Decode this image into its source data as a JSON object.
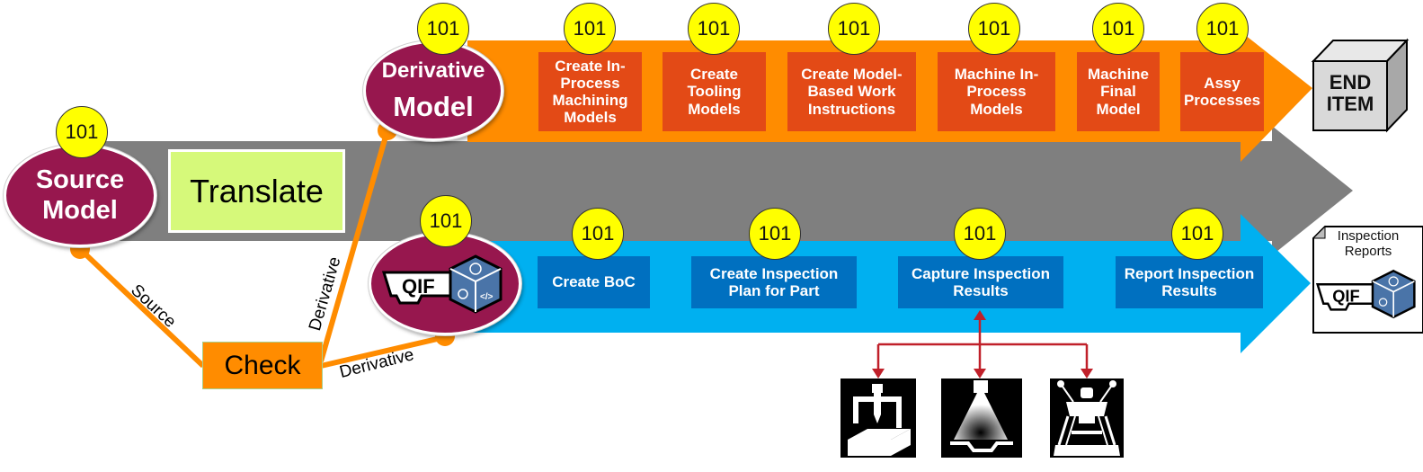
{
  "colors": {
    "orange_arrow": "#ff8c00",
    "orange_step": "#e34a16",
    "gray_arrow": "#7f7f7f",
    "blue_arrow": "#00b0f0",
    "blue_step": "#0070c0",
    "model_ellipse": "#97174e",
    "badge": "#ffff00",
    "translate_box": "#d6f97a",
    "check_box": "#ff8c00",
    "connector": "#ff8c00",
    "device_link": "#c0202a"
  },
  "source_model": {
    "badge": "101",
    "line1": "Source",
    "line2": "Model"
  },
  "translate": {
    "label": "Translate"
  },
  "derivative_model": {
    "badge": "101",
    "line1": "Derivative",
    "line2": "Model"
  },
  "qif_model": {
    "badge": "101",
    "logo": "QIF"
  },
  "check": {
    "label": "Check"
  },
  "connectors": {
    "source_label": "Source",
    "derivative_label_1": "Derivative",
    "derivative_label_2": "Derivative"
  },
  "orange_steps": [
    {
      "badge": "101",
      "lines": [
        "Create In-",
        "Process",
        "Machining",
        "Models"
      ]
    },
    {
      "badge": "101",
      "lines": [
        "Create",
        "Tooling",
        "Models"
      ]
    },
    {
      "badge": "101",
      "lines": [
        "Create Model-",
        "Based Work",
        "Instructions"
      ]
    },
    {
      "badge": "101",
      "lines": [
        "Machine In-",
        "Process",
        "Models"
      ]
    },
    {
      "badge": "101",
      "lines": [
        "Machine",
        "Final",
        "Model"
      ]
    },
    {
      "badge": "101",
      "lines": [
        "Assy",
        "Processes"
      ]
    }
  ],
  "blue_steps": [
    {
      "badge": "101",
      "lines": [
        "Create BoC"
      ]
    },
    {
      "badge": "101",
      "lines": [
        "Create Inspection",
        "Plan for Part"
      ]
    },
    {
      "badge": "101",
      "lines": [
        "Capture Inspection",
        "Results"
      ]
    },
    {
      "badge": "101",
      "lines": [
        "Report Inspection",
        "Results"
      ]
    }
  ],
  "end_item": {
    "line1": "END",
    "line2": "ITEM"
  },
  "inspection_reports": {
    "line1": "Inspection",
    "line2": "Reports",
    "logo": "QIF"
  },
  "devices": [
    {
      "name": "cmm",
      "icon": "coordinate-measuring-machine-icon"
    },
    {
      "name": "scanner",
      "icon": "optical-scanner-icon"
    },
    {
      "name": "arm",
      "icon": "portable-measuring-arm-icon"
    }
  ]
}
